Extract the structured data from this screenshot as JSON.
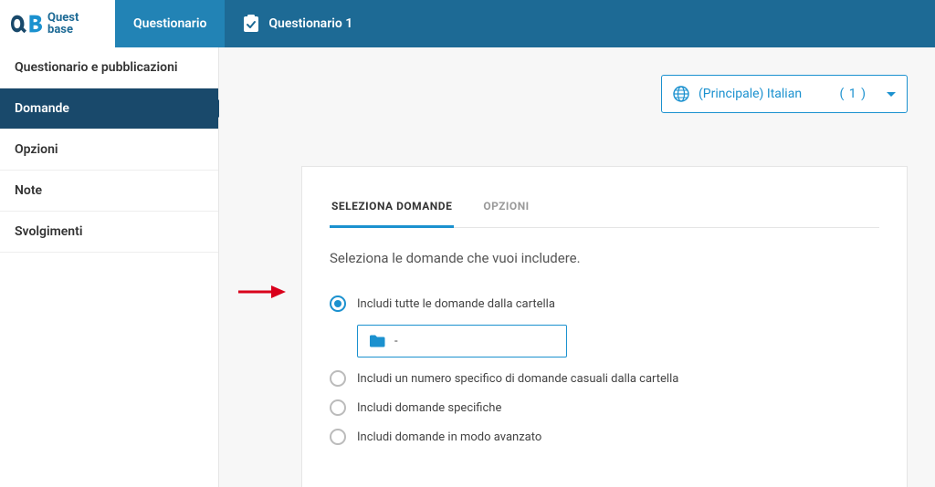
{
  "brand": {
    "line1": "Quest",
    "line2": "base"
  },
  "header": {
    "tab_primary": "Questionario",
    "tab_secondary": "Questionario 1"
  },
  "sidebar": {
    "items": [
      {
        "label": "Questionario e pubblicazioni"
      },
      {
        "label": "Domande"
      },
      {
        "label": "Opzioni"
      },
      {
        "label": "Note"
      },
      {
        "label": "Svolgimenti"
      }
    ]
  },
  "language": {
    "label": "(Principale) Italian",
    "count": "( 1 )"
  },
  "panel": {
    "tabs": {
      "select": "SELEZIONA DOMANDE",
      "options": "OPZIONI"
    },
    "instruction": "Seleziona le domande che vuoi includere.",
    "options": {
      "opt1": "Includi tutte le domande dalla cartella",
      "opt2": "Includi un numero specifico di domande casuali dalla cartella",
      "opt3": "Includi domande specifiche",
      "opt4": "Includi domande in modo avanzato"
    },
    "folder_value": "-"
  }
}
